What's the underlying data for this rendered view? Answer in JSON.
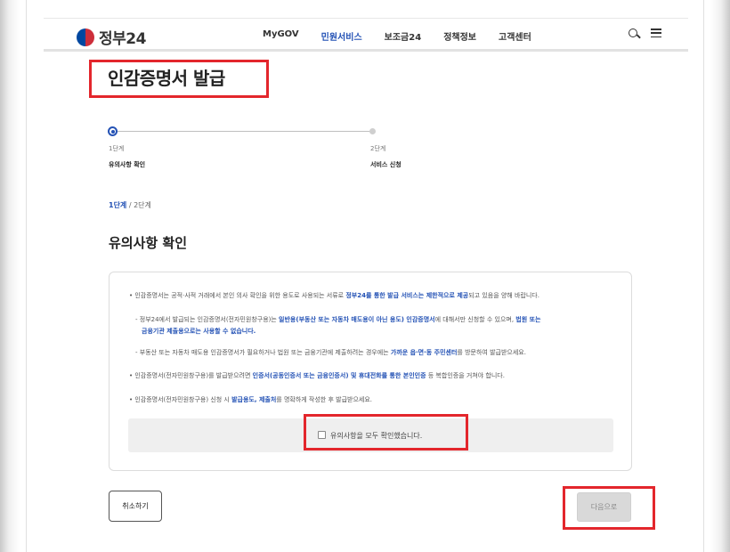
{
  "header": {
    "logo_text": "정부24",
    "nav": [
      "MyGOV",
      "민원서비스",
      "보조금24",
      "정책정보",
      "고객센터"
    ],
    "active_nav": "민원서비스"
  },
  "page_title": "인감증명서 발급",
  "stepper": {
    "steps": [
      {
        "num": "1단계",
        "name": "유의사항 확인"
      },
      {
        "num": "2단계",
        "name": "서비스 신청"
      }
    ]
  },
  "breadcrumb": {
    "current": "1단계",
    "rest": " / 2단계"
  },
  "section_title": "유의사항 확인",
  "notices": {
    "n1_a": "• 인감증명서는 공적·사적 거래에서 본인 의사 확인을 위한 용도로 사용되는 서류로 ",
    "n1_b": "정부24를 통한 발급 서비스는 제한적으로 제공",
    "n1_c": "되고 있음을 양해 바랍니다.",
    "n2_a": "- 정부24에서 발급되는 인감증명서(전자민원창구용)는 ",
    "n2_b": "일반용(부동산 또는 자동차 매도용이 아닌 용도) 인감증명서",
    "n2_c": "에 대해서만 신청할 수 있으며, ",
    "n2_d": "법원 또는",
    "n2_e": "금융기관 제출용으로는 사용할 수 없습니다.",
    "n3_a": "- 부동산 또는 자동차 매도용 인감증명서가 필요하거나 법원 또는 금융기관에 제출하려는 경우에는 ",
    "n3_b": "가까운 읍·면·동 주민센터",
    "n3_c": "를 방문하여 발급받으세요.",
    "n4_a": "• 인감증명서(전자민원창구용)를 발급받으려면 ",
    "n4_b": "인증서(공동인증서 또는 금융인증서) 및 휴대전화를 통한 본인인증",
    "n4_c": " 등 복합인증을 거쳐야 합니다.",
    "n5_a": "• 인감증명서(전자민원창구용) 신청 시 ",
    "n5_b": "발급용도, 제출처",
    "n5_c": "를 명확하게 작성한 후 발급받으세요."
  },
  "confirm_label": "유의사항을 모두 확인했습니다.",
  "buttons": {
    "cancel": "취소하기",
    "next": "다음으로"
  },
  "colors": {
    "accent": "#2452b5",
    "highlight_box": "#e3262c"
  }
}
